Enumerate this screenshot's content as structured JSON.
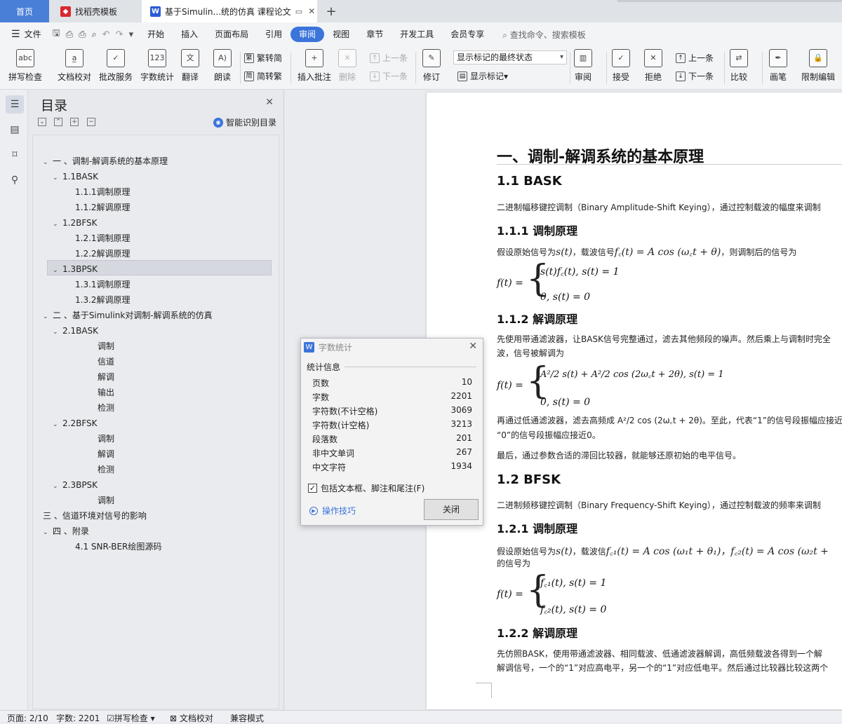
{
  "tabs": {
    "home": "首页",
    "template": "找稻壳模板",
    "document": "基于Simulin...统的仿真 课程论文",
    "add": "+"
  },
  "menu": {
    "file": "文件",
    "items": [
      "开始",
      "插入",
      "页面布局",
      "引用",
      "审阅",
      "视图",
      "章节",
      "开发工具",
      "会员专享"
    ],
    "active": "审阅",
    "search": "查找命令、搜索模板"
  },
  "ribbon": {
    "spellcheck": "拼写检查",
    "doc_proof": "文档校对",
    "revise_service": "批改服务",
    "word_count": "字数统计",
    "translate": "翻译",
    "read_aloud": "朗读",
    "to_traditional": "繁转简",
    "to_simplified": "简转繁",
    "insert_comment": "插入批注",
    "delete": "删除",
    "prev": "上一条",
    "next": "下一条",
    "track": "修订",
    "markup_select": "显示标记的最终状态",
    "show_markup": "显示标记",
    "review": "审阅",
    "accept": "接受",
    "reject": "拒绝",
    "prev2": "上一条",
    "next2": "下一条",
    "compare": "比较",
    "pen": "画笔",
    "restrict": "限制编辑"
  },
  "nav": {
    "title": "目录",
    "smart": "智能识别目录",
    "items": [
      "一 、调制-解调系统的基本原理",
      "1.1BASK",
      "1.1.1调制原理",
      "1.1.2解调原理",
      "1.2BFSK",
      "1.2.1调制原理",
      "1.2.2解调原理",
      "1.3BPSK",
      "1.3.1调制原理",
      "1.3.2解调原理",
      "二 、基于Simulink对调制-解调系统的仿真",
      "2.1BASK",
      "调制",
      "信道",
      "解调",
      "输出",
      "检测",
      "2.2BFSK",
      "调制",
      "解调",
      "检测",
      "2.3BPSK",
      "调制",
      "三 、信道环境对信号的影响",
      "四 、附录",
      "4.1 SNR-BER绘图源码"
    ]
  },
  "doc": {
    "h1": "一、调制-解调系统的基本原理",
    "s11": "1.1 BASK",
    "s11_p": "二进制幅移键控调制（Binary Amplitude-Shift Keying），通过控制载波的幅度来调制",
    "s111": "1.1.1 调制原理",
    "s111_p1": "假设原始信号为",
    "s111_m1": "s(t)",
    "s111_p2": "，载波信号",
    "s111_m2": "f꜀(t) = A cos (ω꜀t + θ)",
    "s111_p3": "，则调制后的信号为",
    "eq1_lhs": "f(t) =",
    "eq1_a": "s(t)f꜀(t), s(t) = 1",
    "eq1_b": "0, s(t) = 0",
    "s112": "1.1.2 解调原理",
    "s112_p1": "先使用带通滤波器，让BASK信号完整通过，滤去其他频段的噪声。然后乘上与调制时完全",
    "s112_p2": "波，信号被解调为",
    "eq2_lhs": "f(t) =",
    "eq2_a": "A²/2 s(t) + A²/2 cos (2ω꜀t + 2θ), s(t) = 1",
    "eq2_b": "0, s(t) = 0",
    "s112_p3": "再通过低通滤波器，滤去高频成 A²/2 cos (2ω꜀t + 2θ)。至此，代表“1”的信号段振幅应接近",
    "s112_p4": "“0”的信号段振幅应接近0。",
    "s112_p5": "最后，通过参数合适的滞回比较器，就能够还原初始的电平信号。",
    "s12": "1.2 BFSK",
    "s12_p": "二进制频移键控调制（Binary Frequency-Shift Keying），通过控制载波的频率来调制",
    "s121": "1.2.1 调制原理",
    "s121_p1": "假设原始信号为",
    "s121_m1": "s(t)",
    "s121_p2": "，载波信",
    "s121_m2": "f꜀₁(t) = A cos (ω₁t + θ₁)，f꜀₂(t) = A cos (ω₂t +",
    "s121_p3": "的信号为",
    "eq3_lhs": "f(t) =",
    "eq3_a": "f꜀₁(t), s(t) = 1",
    "eq3_b": "f꜀₂(t), s(t) = 0",
    "s122": "1.2.2 解调原理",
    "s122_p1": "先仿照BASK，使用带通滤波器、相同载波、低通滤波器解调，高低频载波各得到一个解",
    "s122_p2": "解调信号，一个的“1”对应高电平，另一个的“1”对应低电平。然后通过比较器比较这两个"
  },
  "dialog": {
    "title": "字数统计",
    "section": "统计信息",
    "rows": [
      {
        "label": "页数",
        "value": "10"
      },
      {
        "label": "字数",
        "value": "2201"
      },
      {
        "label": "字符数(不计空格)",
        "value": "3069"
      },
      {
        "label": "字符数(计空格)",
        "value": "3213"
      },
      {
        "label": "段落数",
        "value": "201"
      },
      {
        "label": "非中文单词",
        "value": "267"
      },
      {
        "label": "中文字符",
        "value": "1934"
      }
    ],
    "include": "包括文本框、脚注和尾注(F)",
    "tips": "操作技巧",
    "close": "关闭"
  },
  "status": {
    "page": "页面: 2/10",
    "words": "字数: 2201",
    "spell": "拼写检查",
    "proof": "文档校对",
    "compat": "兼容模式"
  },
  "colors": {
    "accent": "#3b74db",
    "home_tab": "#4a7fd8",
    "doc_icon": "#2b5cd6",
    "tpl_icon": "#d9282f"
  }
}
